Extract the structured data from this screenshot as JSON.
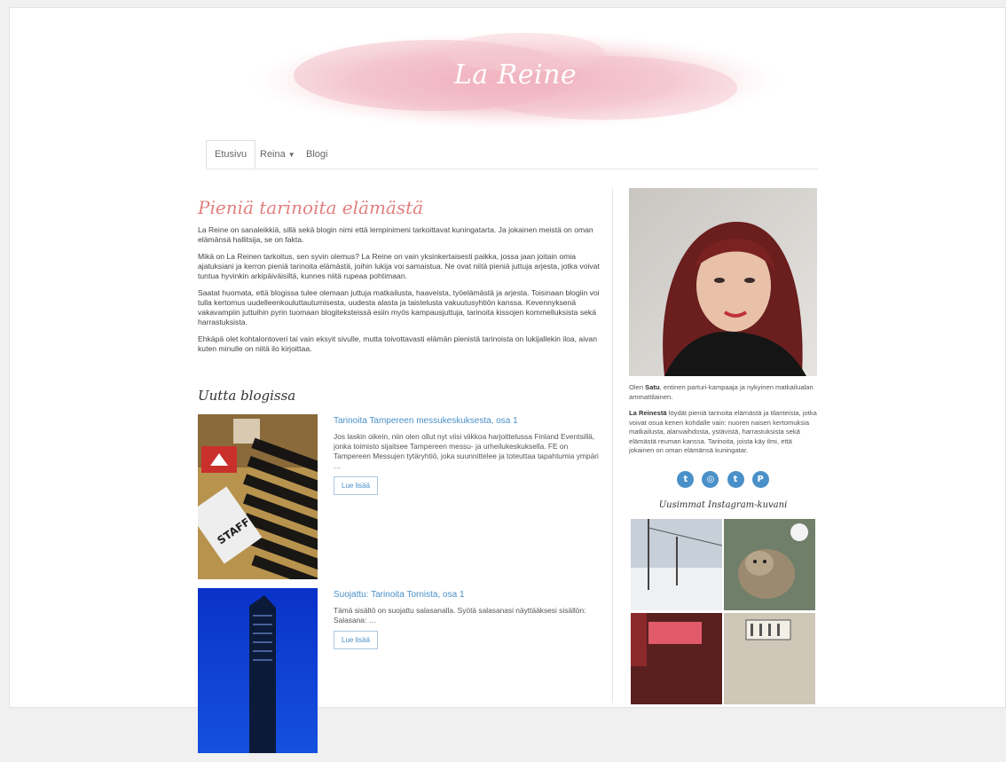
{
  "site": {
    "title": "La Reine"
  },
  "nav": {
    "items": [
      {
        "label": "Etusivu"
      },
      {
        "label": "Reina"
      },
      {
        "label": "Blogi"
      }
    ]
  },
  "main": {
    "title": "Pieniä tarinoita elämästä",
    "paragraphs": [
      "La Reine on sanaleikkiä, sillä sekä blogin nimi että lempinimeni tarkoittavat kuningatarta. Ja jokainen meistä on oman elämänsä hallitsija, se on fakta.",
      "Mikä on La Reinen tarkoitus, sen syvin olemus? La Reine on vain yksinkertaisesti paikka, jossa jaan joitain omia ajatuksiani ja kerron pieniä tarinoita elämästä, joihin lukija voi samaistua. Ne ovat niitä pieniä juttuja arjesta, jotka voivat tuntua hyvinkin arkipäiväisiltä, kunnes niitä rupeaa pohtimaan.",
      "Saatat huomata, että blogissa tulee olemaan juttuja matkailusta, haaveista, työelämästä ja arjesta. Toisinaan blogiin voi tulla kertomus uudelleenkouluttautumisesta, uudesta alasta ja taistelusta vakuutusyhtiön kanssa. Kevennyksenä vakavampiin juttuihin pyrin tuomaan blogiteksteissä esiin myös kampausjuttuja, tarinoita kissojen kommelluksista sekä harrastuksista.",
      "Ehkäpä olet kohtalontoveri tai vain eksyit sivulle, mutta toivottavasti elämän pienistä tarinoista on lukijallekin iloa, aivan kuten minulle on niitä ilo kirjoittaa."
    ],
    "section_title": "Uutta blogissa",
    "posts": [
      {
        "title": "Tarinoita Tampereen messukeskuksesta, osa 1",
        "excerpt": "Jos laskin oikein, niin olen ollut nyt viisi viikkoa harjoittelussa Finland Eventsillä, jonka toimisto sijaitsee Tampereen messu- ja urheilukeskuksella. FE on Tampereen Messujen tytäryhtiö, joka suunnittelee ja toteuttaa tapahtumia ympäri …",
        "button": "Lue lisää",
        "image_text": "STAFF"
      },
      {
        "title": "Suojattu: Tarinoita Tornista, osa 1",
        "excerpt": "Tämä sisältö on suojattu salasanalla. Syötä salasanasi näyttääksesi sisällön: Salasana: …",
        "button": "Lue lisää"
      }
    ]
  },
  "sidebar": {
    "bio1_pre": "Olen ",
    "bio1_name": "Satu",
    "bio1_post": ", entinen parturi-kampaaja ja nykyinen matkailualan ammattilainen.",
    "bio2_name": "La Reinestä",
    "bio2_post": " löydät pieniä tarinoita elämästä ja tilanteista, jotka voivat osua kenen kohdalle vain: nuoren naisen kertomuksia matkailusta, alanvaihdosta, ystävistä, harrastuksista sekä elämästä reuman kanssa. Tarinoita, joista käy ilmi, että jokainen on oman elämänsä kuningatar.",
    "socials": [
      {
        "icon": "twitter-icon",
        "glyph": "t"
      },
      {
        "icon": "instagram-icon",
        "glyph": "◎"
      },
      {
        "icon": "tumblr-icon",
        "glyph": "t"
      },
      {
        "icon": "pinterest-icon",
        "glyph": "P"
      }
    ],
    "instagram_title": "Uusimmat Instagram-kuvani"
  },
  "colors": {
    "accent": "#4a90c8",
    "title_pink": "#e27f7f",
    "watercolor": "#f2b8c3"
  }
}
